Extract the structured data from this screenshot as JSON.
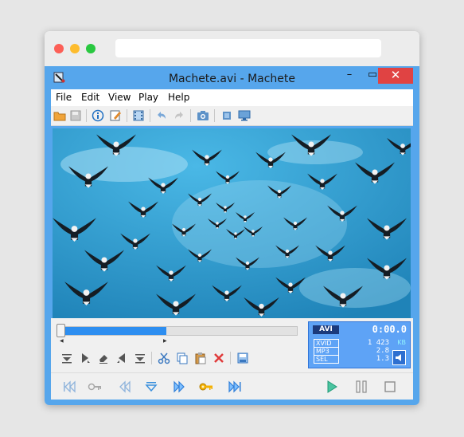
{
  "window": {
    "title": "Machete.avi - Machete",
    "minimize_symbol": "–",
    "maximize_symbol": "▭",
    "close_symbol": "✕"
  },
  "menu": [
    {
      "label": "File"
    },
    {
      "label": "Edit"
    },
    {
      "label": "View"
    },
    {
      "label": "Play"
    },
    {
      "label": "Help"
    }
  ],
  "toolbar_icons": [
    "open-folder-icon",
    "save-icon",
    "info-icon",
    "edit-icon",
    "film-strip-icon",
    "undo-icon",
    "redo-icon",
    "snapshot-camera-icon",
    "fullscreen-icon",
    "monitor-icon"
  ],
  "timeline": {
    "position_fraction": 0.0,
    "selection_fraction": 0.45
  },
  "edit_icons": [
    "set-start-icon",
    "cursor-icon",
    "erase-icon",
    "nudge-left-icon",
    "set-end-icon",
    "cut-icon",
    "copy-icon",
    "paste-icon",
    "delete-icon",
    "save-selection-icon"
  ],
  "info": {
    "container": "AVI",
    "time": "0:00.0",
    "rows": [
      {
        "label": "XVID",
        "value": "1 423"
      },
      {
        "label": "MP3",
        "value": "2.8"
      },
      {
        "label": "SEL",
        "value": "1.3"
      }
    ],
    "unit": "KB"
  },
  "transport_icons": [
    "skip-to-start-icon",
    "key-prev-icon",
    "rewind-icon",
    "mark-icon",
    "fast-forward-icon",
    "keyframe-icon",
    "skip-to-end-icon",
    "play-icon",
    "pause-icon",
    "stop-icon"
  ],
  "colors": {
    "accent": "#56a6ec",
    "close": "#e04343",
    "progress": "#2d8ef0",
    "sky": "#2a8fc4"
  }
}
